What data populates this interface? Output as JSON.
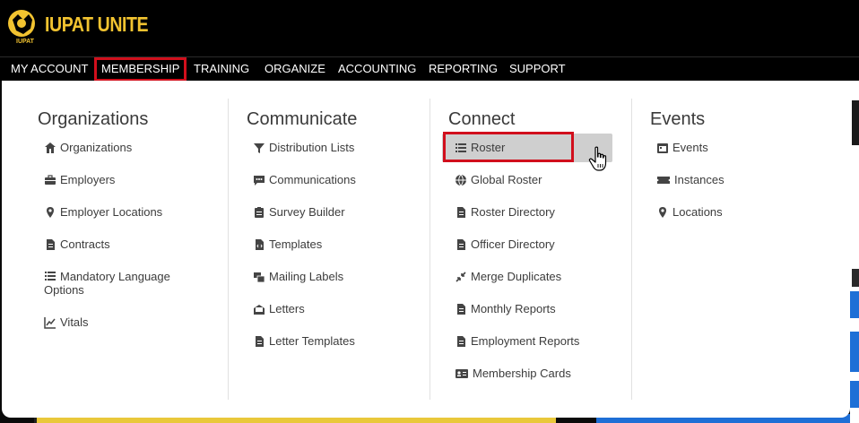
{
  "app": {
    "logo_text": "IUPAT UNITE",
    "logo_sub": "IUPAT"
  },
  "colors": {
    "brand_yellow": "#f2c330",
    "highlight_red": "#d10f1c",
    "hover_gray": "#cfcfcf"
  },
  "nav": [
    {
      "label": "MY ACCOUNT"
    },
    {
      "label": "MEMBERSHIP",
      "active": true
    },
    {
      "label": "TRAINING"
    },
    {
      "label": "ORGANIZE"
    },
    {
      "label": "ACCOUNTING"
    },
    {
      "label": "REPORTING"
    },
    {
      "label": "SUPPORT"
    }
  ],
  "menu": {
    "organizations": {
      "title": "Organizations",
      "items": [
        {
          "label": "Organizations",
          "icon": "building-icon"
        },
        {
          "label": "Employers",
          "icon": "briefcase-icon"
        },
        {
          "label": "Employer Locations",
          "icon": "map-marker-icon"
        },
        {
          "label": "Contracts",
          "icon": "file-contract-icon"
        },
        {
          "label": "Mandatory Language Options",
          "icon": "list-icon"
        },
        {
          "label": "Vitals",
          "icon": "chart-line-icon"
        }
      ]
    },
    "communicate": {
      "title": "Communicate",
      "items": [
        {
          "label": "Distribution Lists",
          "icon": "filter-icon"
        },
        {
          "label": "Communications",
          "icon": "comment-dots-icon"
        },
        {
          "label": "Survey Builder",
          "icon": "clipboard-list-icon"
        },
        {
          "label": "Templates",
          "icon": "file-code-icon"
        },
        {
          "label": "Mailing Labels",
          "icon": "mail-bulk-icon"
        },
        {
          "label": "Letters",
          "icon": "envelope-open-icon"
        },
        {
          "label": "Letter Templates",
          "icon": "file-alt-icon"
        }
      ]
    },
    "connect": {
      "title": "Connect",
      "items": [
        {
          "label": "Roster",
          "icon": "list-ul-icon"
        },
        {
          "label": "Global Roster",
          "icon": "globe-icon"
        },
        {
          "label": "Roster Directory",
          "icon": "file-alt-icon"
        },
        {
          "label": "Officer Directory",
          "icon": "file-alt-icon"
        },
        {
          "label": "Merge Duplicates",
          "icon": "compress-icon"
        },
        {
          "label": "Monthly Reports",
          "icon": "file-alt-icon"
        },
        {
          "label": "Employment Reports",
          "icon": "file-alt-icon"
        },
        {
          "label": "Membership Cards",
          "icon": "id-card-icon"
        }
      ]
    },
    "events": {
      "title": "Events",
      "items": [
        {
          "label": "Events",
          "icon": "calendar-icon"
        },
        {
          "label": "Instances",
          "icon": "ticket-icon"
        },
        {
          "label": "Locations",
          "icon": "map-marker-icon"
        }
      ]
    }
  }
}
